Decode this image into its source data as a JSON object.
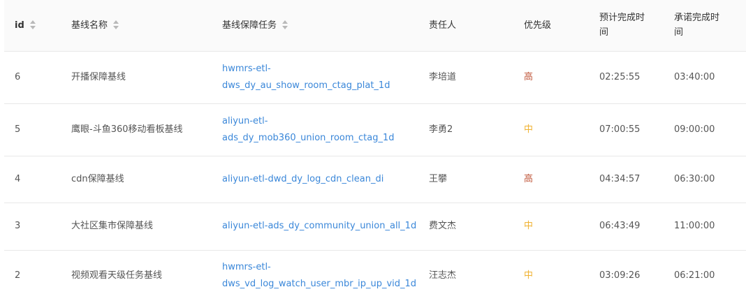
{
  "colors": {
    "link": "#3a87d9",
    "priority_high": "#c0563a",
    "priority_medium": "#f0b232",
    "header_bg": "#fafafa",
    "border": "#e8e8e8"
  },
  "table": {
    "headers": {
      "id": "id",
      "name": "基线名称",
      "task": "基线保障任务",
      "owner": "责任人",
      "priority": "优先级",
      "expected_line1": "预计完成时",
      "expected_line2": "间",
      "promised_line1": "承诺完成时",
      "promised_line2": "间"
    },
    "rows": [
      {
        "id": "6",
        "name": "开播保障基线",
        "task_line1": "hwmrs-etl-",
        "task_line2": "dws_dy_au_show_room_ctag_plat_1d",
        "owner": "李培道",
        "priority": "高",
        "priority_level": "high",
        "expected": "02:25:55",
        "promised": "03:40:00"
      },
      {
        "id": "5",
        "name": "鹰眼-斗鱼360移动看板基线",
        "task_line1": "aliyun-etl-",
        "task_line2": "ads_dy_mob360_union_room_ctag_1d",
        "owner": "李勇2",
        "priority": "中",
        "priority_level": "medium",
        "expected": "07:00:55",
        "promised": "09:00:00"
      },
      {
        "id": "4",
        "name": "cdn保障基线",
        "task_line1": "aliyun-etl-dwd_dy_log_cdn_clean_di",
        "task_line2": "",
        "owner": "王攀",
        "priority": "高",
        "priority_level": "high",
        "expected": "04:34:57",
        "promised": "06:30:00"
      },
      {
        "id": "3",
        "name": "大社区集市保障基线",
        "task_line1": "aliyun-etl-ads_dy_community_union_all_1d",
        "task_line2": "",
        "owner": "费文杰",
        "priority": "中",
        "priority_level": "medium",
        "expected": "06:43:49",
        "promised": "11:00:00"
      },
      {
        "id": "2",
        "name": "视频观看天级任务基线",
        "task_line1": "hwmrs-etl-",
        "task_line2": "dws_vd_log_watch_user_mbr_ip_up_vid_1d",
        "owner": "汪志杰",
        "priority": "中",
        "priority_level": "medium",
        "expected": "03:09:26",
        "promised": "06:21:00"
      }
    ]
  }
}
